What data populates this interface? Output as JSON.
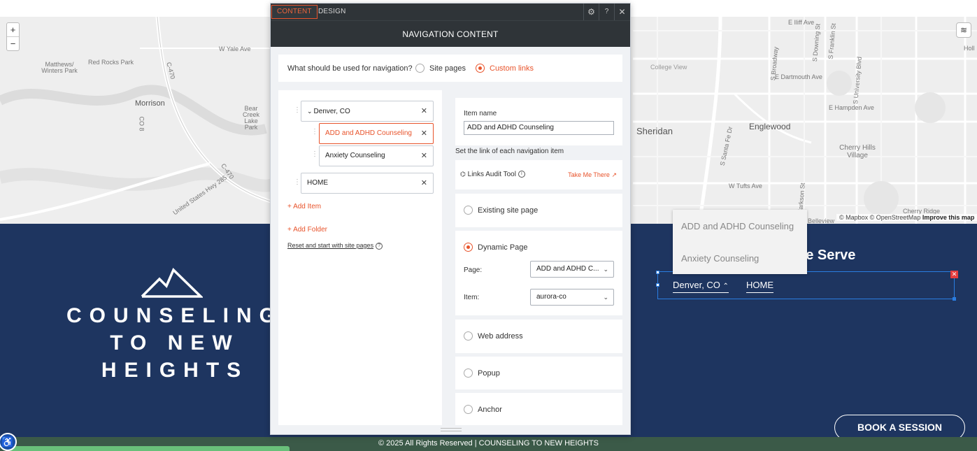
{
  "map": {
    "labels": [
      "W Yale Ave",
      "Red Rocks Park",
      "Matthews/ Winters Park",
      "C-470",
      "Morrison",
      "Bear Creek Lake Park",
      "CO 8",
      "C-470",
      "United States Hwy 285",
      "College View",
      "E Dartmouth Ave",
      "E Hampden Ave",
      "Sheridan",
      "Englewood",
      "Cherry Hills Village",
      "W Tufts Ave",
      "Belleview",
      "Cherry Ridge",
      "E Iliff Ave",
      "S Broadway",
      "S Downing St",
      "S Franklin St",
      "S University Blvd",
      "S Santa Fe Dr",
      "S Clarkson St",
      "Holl"
    ],
    "zoom_in": "+",
    "zoom_out": "−",
    "attribution": "© Mapbox © OpenStreetMap",
    "improve": "Improve this map"
  },
  "editor": {
    "tabs": [
      "CONTENT",
      "DESIGN"
    ],
    "header_title": "NAVIGATION CONTENT",
    "nav_source": {
      "question": "What should be used for navigation?",
      "options": [
        "Site pages",
        "Custom links"
      ],
      "selected": "Custom links"
    },
    "tree": {
      "items": [
        {
          "label": "Denver, CO"
        },
        {
          "label": "ADD and ADHD Counseling"
        },
        {
          "label": "Anxiety Counseling"
        },
        {
          "label": "HOME"
        }
      ],
      "add_item": "Add Item",
      "add_folder": "Add Folder",
      "reset": "Reset and start with site pages"
    },
    "item_name": {
      "label": "Item name",
      "value": "ADD and ADHD Counseling"
    },
    "link_hint": "Set the link of each navigation item",
    "audit": {
      "label": "Links Audit Tool",
      "link": "Take Me There"
    },
    "link_types": {
      "existing": "Existing site page",
      "dynamic": "Dynamic Page",
      "web": "Web address",
      "popup": "Popup",
      "anchor": "Anchor",
      "selected": "Dynamic Page"
    },
    "dynamic": {
      "page_label": "Page:",
      "page_value": "ADD and ADHD C...",
      "item_label": "Item:",
      "item_value": "aurora-co"
    }
  },
  "site": {
    "logo_lines": [
      "COUNSELING",
      "TO NEW",
      "HEIGHTS"
    ],
    "serve_heading": "Ve Serve",
    "nav_links": [
      "Denver, CO",
      "HOME"
    ],
    "dropdown_items": [
      "ADD and ADHD Counseling",
      "Anxiety Counseling"
    ],
    "book_button": "BOOK A SESSION",
    "copyright": "© 2025 All Rights Reserved | COUNSELING TO NEW HEIGHTS"
  },
  "colors": {
    "accent": "#e8542c",
    "footer_bg": "#1e3560",
    "copyright_bg": "#3b5a48",
    "selection": "#2a7de1"
  }
}
